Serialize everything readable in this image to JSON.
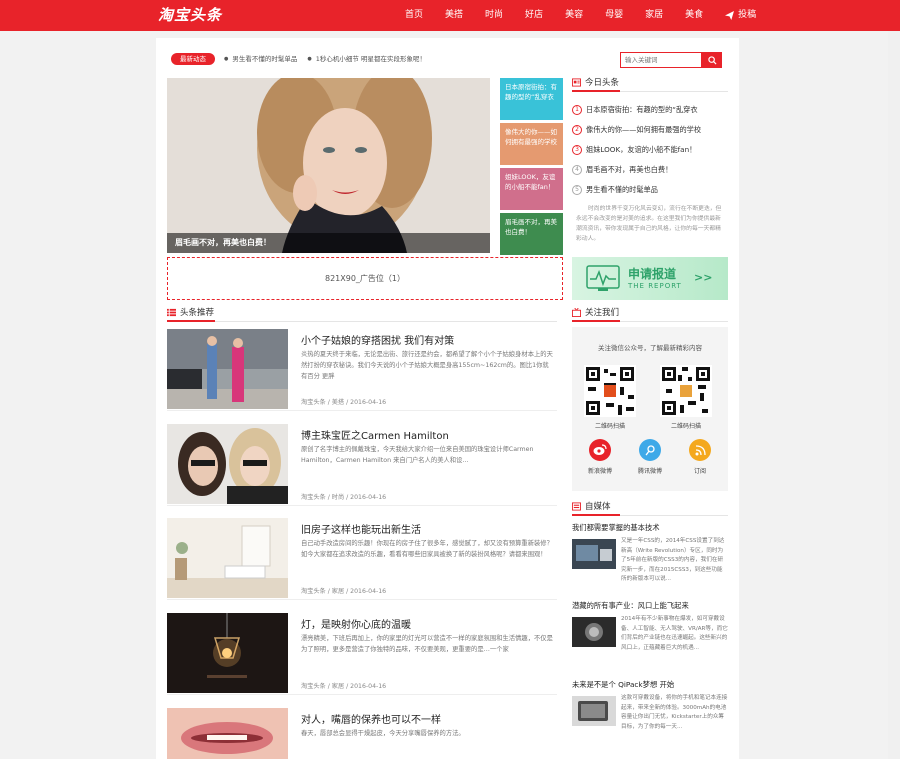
{
  "header": {
    "logo": "淘宝头条",
    "nav": [
      "首页",
      "美搭",
      "时尚",
      "好店",
      "美容",
      "母婴",
      "家居",
      "美食"
    ],
    "contribute": "投稿"
  },
  "ticker": {
    "tag": "最新动态",
    "items": [
      "男生看不懂的时髦单品",
      "1秒心机小细节 明星都在实段形象呢！"
    ]
  },
  "search": {
    "placeholder": "输入关键词"
  },
  "hero": {
    "caption": "眉毛画不对，再美也白费！"
  },
  "tiles": [
    {
      "text": "日本原宿街拍：有趣的型的“乱穿衣",
      "color": "#39c2d8"
    },
    {
      "text": "像伟大的你——如何拥有最强的学校",
      "color": "#e59a70"
    },
    {
      "text": "姐妹LOOK，友谊的小船不能fan！",
      "color": "#d06f8c"
    },
    {
      "text": "眉毛画不对，再美也白费！",
      "color": "#3e8c4f"
    }
  ],
  "ad": {
    "label": "821X90_广告位（1）"
  },
  "feed": {
    "title": "头条推荐",
    "articles": [
      {
        "title": "小个子姑娘的穿搭困扰 我们有对策",
        "excerpt": "炎热的夏天终于来临，无论是出街、旅行还是约会，都希望了解个小个子姑娘身材本上的天然打扮的穿衣秘诀。我们今天说的小个子姑娘大概是身高155cm~162cm的。图比1你就有百分 更胖",
        "meta": "淘宝头条 / 美搭 / 2016-04-16"
      },
      {
        "title": "博主珠宝匠之Carmen Hamilton",
        "excerpt": "原创了名字博主的佩戴珠宝，今天我给大家介绍一位来自美国的珠宝设计师Carmen Hamilton，Carmen Hamilton 来自门户名人的美人和设...",
        "meta": "淘宝头条 / 时尚 / 2016-04-16"
      },
      {
        "title": "旧房子这样也能玩出新生活",
        "excerpt": "自己动手改造房间的乐趣！你现在的房子住了很多年，感觉腻了，却又没有预算重新装修？如今大家都在追求改造的乐趣，看看有哪些旧家具被换了新的装扮风格呢？请都来围观！",
        "meta": "淘宝头条 / 家居 / 2016-04-16"
      },
      {
        "title": "灯，是映射你心底的温暖",
        "excerpt": "漂亮精美，下班后再加上，你的家里的灯光可以营造不一样的家庭氛围和生活情趣，不仅是为了照明，更多是营造了你独特的品味，不仅要美观，更重要的是…一个家",
        "meta": "淘宝头条 / 家居 / 2016-04-16"
      },
      {
        "title": "对人，嘴唇的保养也可以不一样",
        "excerpt": "春天，唇部总会显得干燥起皮，今天分享嘴唇保养的方法。",
        "meta": ""
      }
    ]
  },
  "sidebar": {
    "today_title": "今日头条",
    "today_list": [
      "日本原宿街拍：有趣的型的“乱穿衣",
      "像伟大的你——如何拥有最强的学校",
      "姐妹LOOK，友谊的小船不能fan！",
      "眉毛画不对，再美也白费！",
      "男生看不懂的时髦单品"
    ],
    "intro": "时尚的世界千变万化风云变幻，流行在不断更迭，但永远不会改变的是对美的追求。在这里我们为你提供最新潮流资讯，带你发现属于自己的风格，让你的每一天都精彩动人。",
    "report": {
      "cn": "申请报道",
      "en": "THE REPORT",
      "arrows": ">>"
    },
    "follow": {
      "title": "关注我们",
      "note": "关注微信公众号，了解最新精彩内容",
      "qr1": "二维码扫描",
      "qr2": "二维码扫描",
      "social": [
        {
          "label": "新浪微博",
          "icon": "weibo-icon",
          "color": "#e8232a"
        },
        {
          "label": "腾讯微博",
          "icon": "tencent-weibo-icon",
          "color": "#3ea9e8"
        },
        {
          "label": "订阅",
          "icon": "rss-icon",
          "color": "#f4a81d"
        }
      ]
    },
    "media_title": "自媒体",
    "media": [
      {
        "title": "我们都需要掌握的基本技术",
        "text": "又是一年CSS的，2014年CSS设置了到达新高（Write Revolution）专区，同时为了5年前在新版的CSS3的内容，我们在研究新一步，而在2015CSS3，到这些功能所的新版本可以说..."
      },
      {
        "title": "潜藏的所有事产业：风口上能飞起来",
        "text": "2014年有不少新事物在爆发，如可穿戴设备、人工智能、无人驾驶、VR/AR等，而它们背后的产业链也在迅速崛起。这些新兴的风口上，正蕴藏着巨大的机遇..."
      },
      {
        "title": "未来是不是个 QiPack梦想 开始",
        "text": "这款可穿戴设备，将你的手机和笔记本连接起来，带来全新的体验。3000mAh的电池容量让你出门无忧，Kickstarter上的众筹目标，为了你的每一天..."
      }
    ]
  }
}
